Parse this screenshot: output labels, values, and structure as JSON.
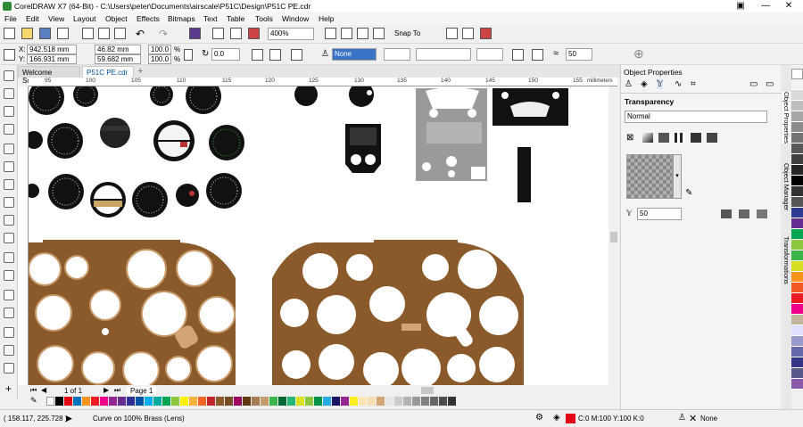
{
  "window": {
    "title": "CorelDRAW X7 (64-Bit) - C:\\Users\\peter\\Documents\\airscale\\P51C\\Design\\P51C PE.cdr",
    "min": "—",
    "close": "✕"
  },
  "menu": [
    "File",
    "Edit",
    "View",
    "Layout",
    "Object",
    "Effects",
    "Bitmaps",
    "Text",
    "Table",
    "Tools",
    "Window",
    "Help"
  ],
  "toolbar": {
    "zoom": "400%",
    "snap": "Snap To"
  },
  "propbar": {
    "x": "942.518 mm",
    "y": "166.931 mm",
    "w": "46.82 mm",
    "h": "59.682 mm",
    "sx": "100.0",
    "sy": "100.0",
    "pct": "%",
    "rotation": "0.0",
    "fill": "None",
    "smoothing": "50"
  },
  "doc_tabs": [
    "Welcome Screen",
    "P51C PE.cdr"
  ],
  "ruler": {
    "unit": "millimeters",
    "h_ticks": [
      "95",
      "100",
      "105",
      "110",
      "115",
      "120",
      "125",
      "130",
      "135",
      "140",
      "145",
      "150",
      "155"
    ]
  },
  "pagenav": {
    "count": "1 of 1",
    "page": "Page 1"
  },
  "status": {
    "coords": "( 158.117, 225.728 )",
    "object": "Curve on 100% Brass (Lens)",
    "fill": "C:0 M:100 Y:100 K:0",
    "outline": "None"
  },
  "docker": {
    "title": "Object Properties",
    "section": "Transparency",
    "mode": "Normal",
    "amount": "50"
  },
  "docker_tabs": [
    "Object Properties",
    "Object Manager",
    "Transformations"
  ],
  "colors": {
    "brass": "#8b5a2b",
    "panel": "#999999",
    "accent": "#0078d7"
  }
}
